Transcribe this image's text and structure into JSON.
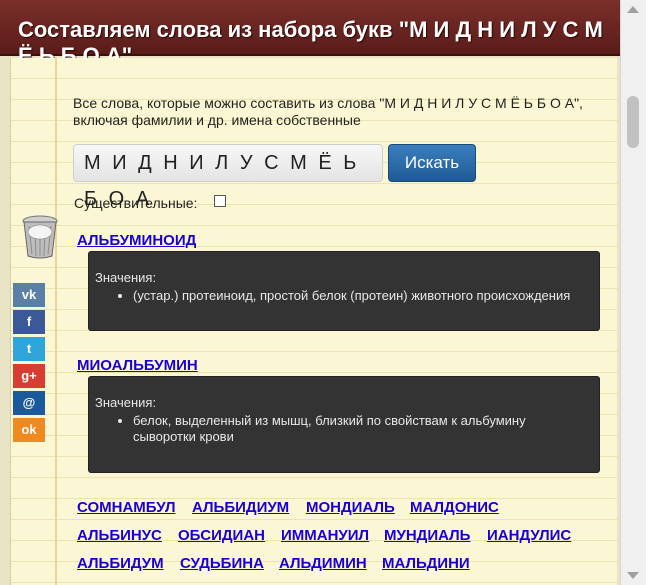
{
  "header": {
    "title": "Составляем слова из набора букв \"М И Д Н И Л У С М Ё Ь Б О А\""
  },
  "intro": {
    "text": "Все слова, которые можно составить из слова \"М И Д Н И Л У С М Ё Ь Б О А\", включая фамилии и др. имена собственные"
  },
  "search": {
    "value": "М И Д Н И Л У С М Ё Ь Б О А",
    "button_label": "Искать"
  },
  "filter": {
    "nouns_label": "Существительные:",
    "nouns_checked": false
  },
  "social": [
    {
      "name": "vk",
      "glyph": "vk",
      "color": "#5b7fa6"
    },
    {
      "name": "facebook",
      "glyph": "f",
      "color": "#3b5998"
    },
    {
      "name": "twitter",
      "glyph": "t",
      "color": "#2fa5d9"
    },
    {
      "name": "google-plus",
      "glyph": "g+",
      "color": "#d73d32"
    },
    {
      "name": "mail",
      "glyph": "@",
      "color": "#1a5a9c"
    },
    {
      "name": "odnoklassniki",
      "glyph": "ok",
      "color": "#f0891e"
    }
  ],
  "entries": [
    {
      "word": "АЛЬБУМИНОИД",
      "meanings_label": "Значения:",
      "meanings": [
        "(устар.) протеиноид, простой белок (протеин) животного происхождения"
      ]
    },
    {
      "word": "МИОАЛЬБУМИН",
      "meanings_label": "Значения:",
      "meanings": [
        "белок, выделенный из мышц, близкий по свойствам к альбумину сыворотки крови"
      ]
    }
  ],
  "word_rows": [
    [
      "СОМНАМБУЛ",
      "АЛЬБИДИУМ",
      "МОНДИАЛЬ",
      "МАЛДОНИС"
    ],
    [
      "АЛЬБИНУС",
      "ОБСИДИАН",
      "ИММАНУИЛ",
      "МУНДИАЛЬ",
      "ИАНДУЛИС"
    ],
    [
      "АЛЬБИДУМ",
      "СУДЬБИНА",
      "АЛЬДИМИН",
      "МАЛЬДИНИ"
    ]
  ]
}
